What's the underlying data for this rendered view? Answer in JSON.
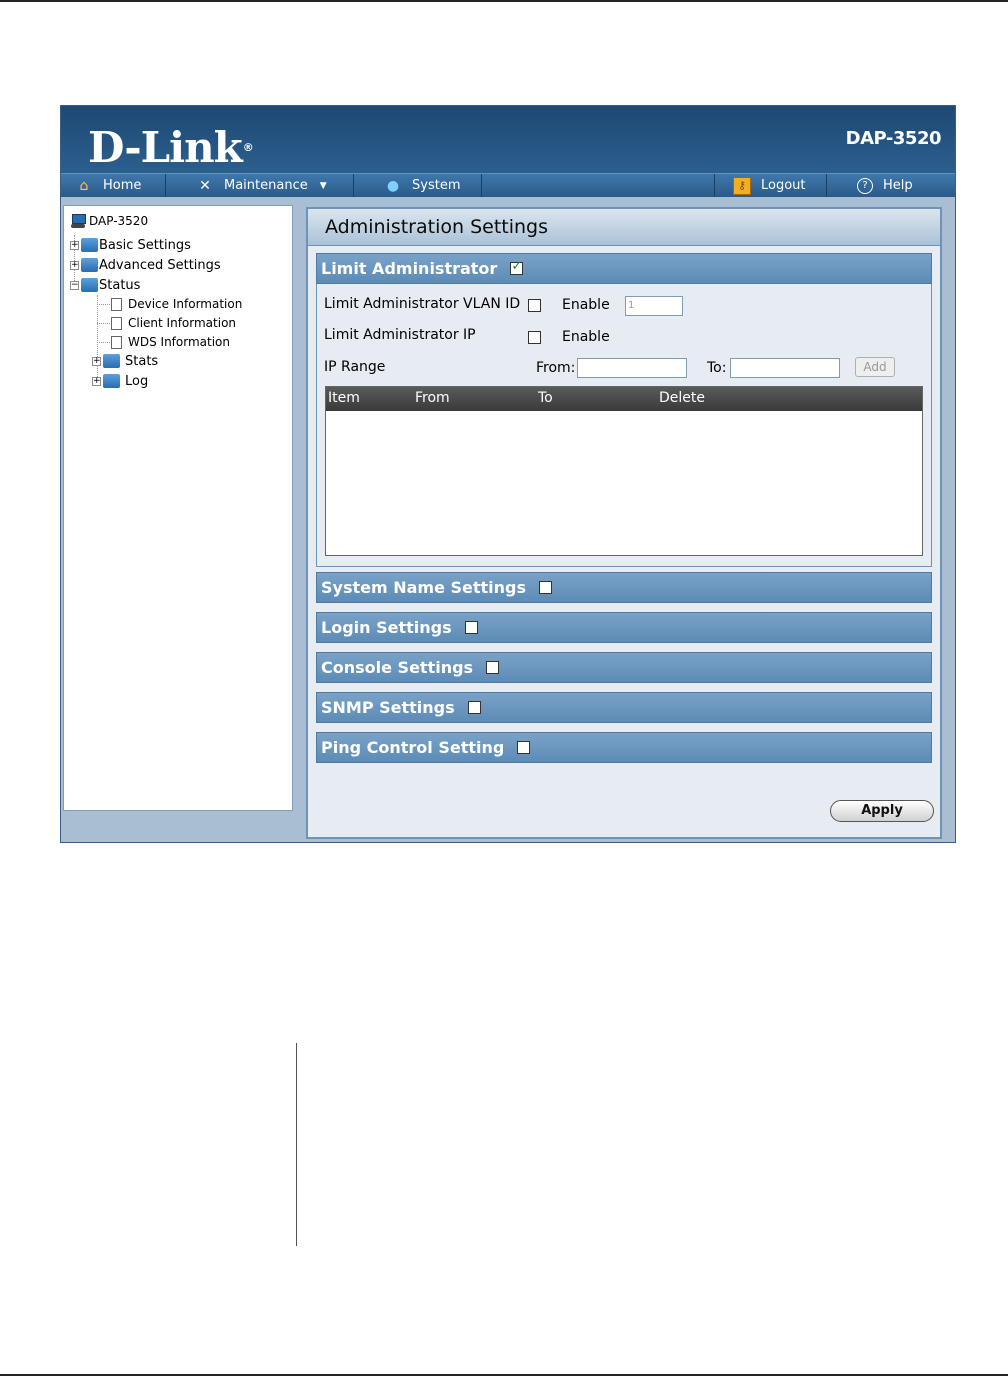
{
  "brand": {
    "logo": "D-Link",
    "registered": "®",
    "model": "DAP-3520"
  },
  "nav": {
    "home": "Home",
    "maintenance": "Maintenance",
    "dropdown_arrow": "▼",
    "system": "System",
    "logout": "Logout",
    "help": "Help",
    "icons": {
      "home": "home-icon",
      "maintenance": "tools-icon",
      "system": "system-icon",
      "logout": "logout-icon",
      "help": "help-icon"
    }
  },
  "tree": {
    "root": "DAP-3520",
    "basic": "Basic Settings",
    "advanced": "Advanced Settings",
    "status": "Status",
    "device_info": "Device Information",
    "client_info": "Client Information",
    "wds_info": "WDS Information",
    "stats": "Stats",
    "log": "Log",
    "expand_symbol": "+",
    "collapse_symbol": "−"
  },
  "content": {
    "title": "Administration Settings",
    "limit_admin": {
      "header": "Limit Administrator",
      "checked": true,
      "vlan_label": "Limit Administrator VLAN ID",
      "vlan_enable": "Enable",
      "vlan_value": "1",
      "ip_label": "Limit Administrator IP",
      "ip_enable": "Enable",
      "range_label": "IP Range",
      "from_label": "From:",
      "to_label": "To:",
      "add_label": "Add",
      "table_headers": [
        "Item",
        "From",
        "To",
        "Delete"
      ]
    },
    "sections": [
      {
        "label": "System Name Settings",
        "checked": false
      },
      {
        "label": "Login Settings",
        "checked": false
      },
      {
        "label": "Console Settings",
        "checked": false
      },
      {
        "label": "SNMP Settings",
        "checked": false
      },
      {
        "label": "Ping Control Setting",
        "checked": false
      }
    ],
    "apply_label": "Apply"
  }
}
